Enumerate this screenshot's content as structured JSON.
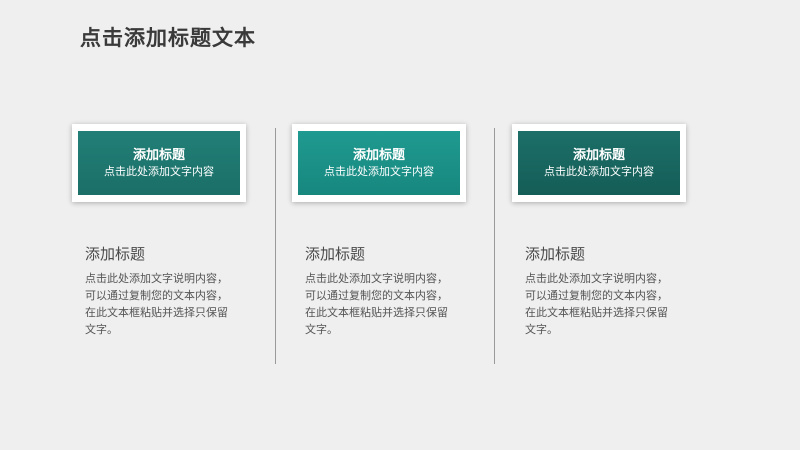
{
  "page": {
    "title": "点击添加标题文本"
  },
  "colors": {
    "background": "#efefef",
    "accent_1": "#1e7a73",
    "accent_2": "#1b9188",
    "accent_3": "#196760",
    "title_text": "#3a3a3a"
  },
  "columns": [
    {
      "card_title": "添加标题",
      "card_subtitle": "点击此处添加文字内容",
      "heading": "添加标题",
      "body": "点击此处添加文字说明内容，可以通过复制您的文本内容，在此文本框粘贴并选择只保留文字。"
    },
    {
      "card_title": "添加标题",
      "card_subtitle": "点击此处添加文字内容",
      "heading": "添加标题",
      "body": "点击此处添加文字说明内容，可以通过复制您的文本内容，在此文本框粘贴并选择只保留文字。"
    },
    {
      "card_title": "添加标题",
      "card_subtitle": "点击此处添加文字内容",
      "heading": "添加标题",
      "body": "点击此处添加文字说明内容，可以通过复制您的文本内容，在此文本框粘贴并选择只保留文字。"
    }
  ]
}
